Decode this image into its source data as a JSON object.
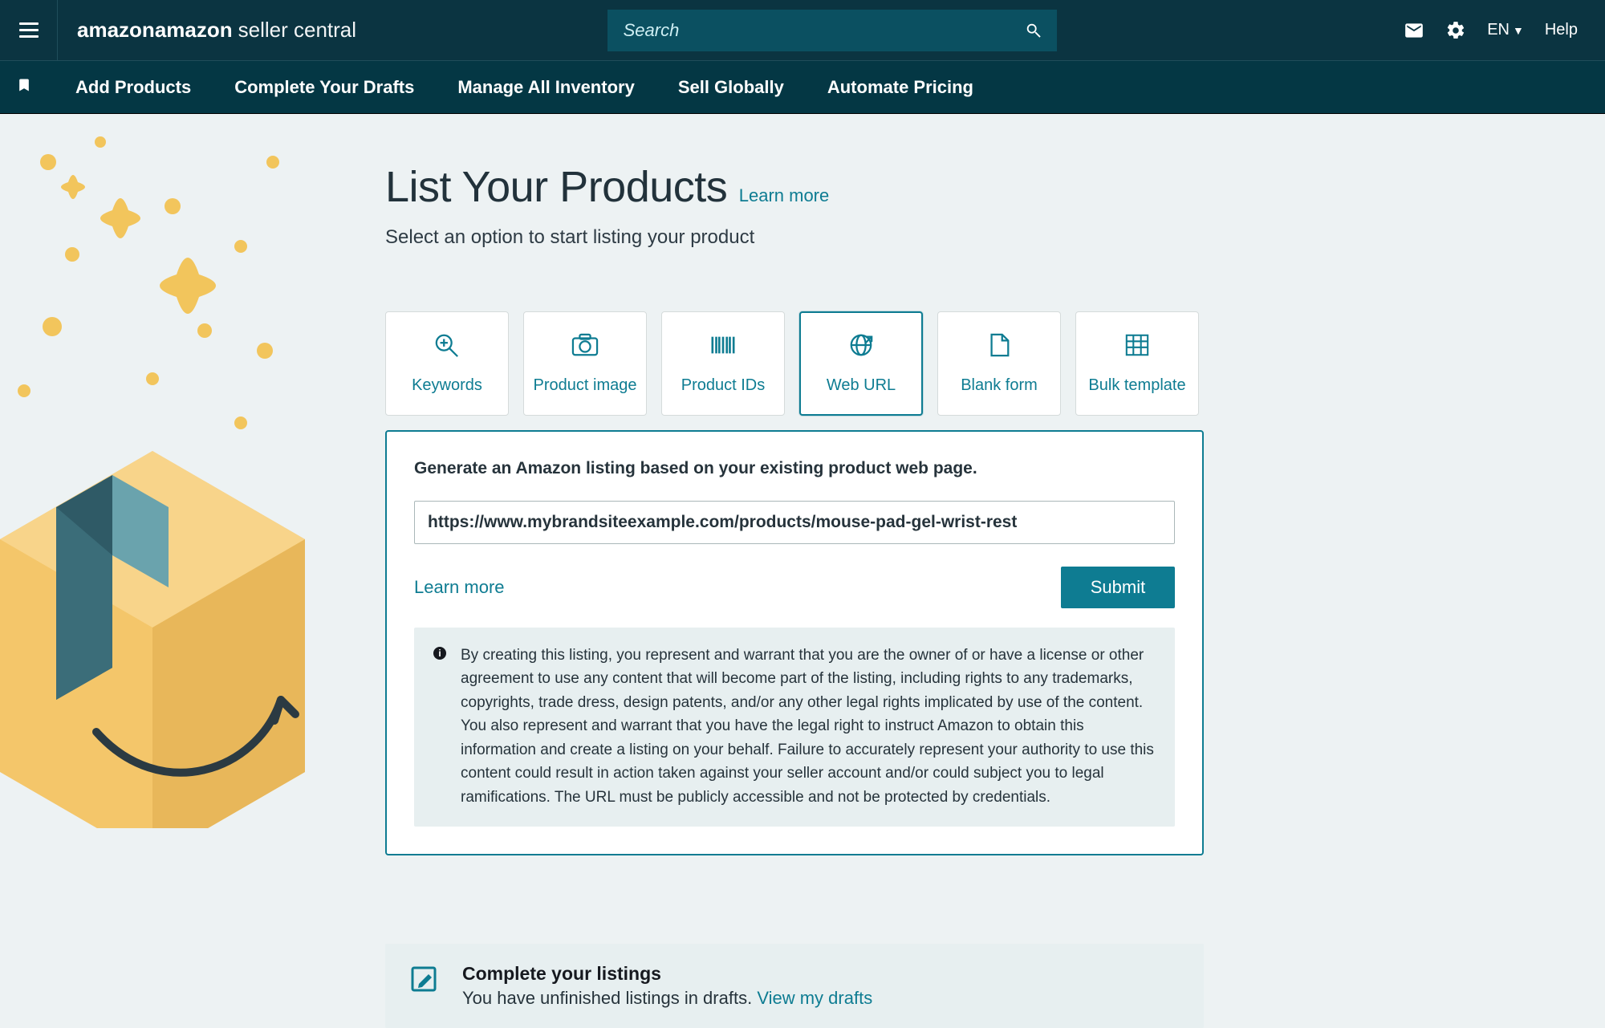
{
  "brand": {
    "first": "amazon",
    "second": "seller central"
  },
  "search": {
    "placeholder": "Search"
  },
  "lang": "EN",
  "help": "Help",
  "nav": {
    "items": [
      "Add Products",
      "Complete Your Drafts",
      "Manage All Inventory",
      "Sell Globally",
      "Automate Pricing"
    ]
  },
  "page": {
    "title": "List Your Products",
    "learn_more": "Learn more",
    "subtitle": "Select an option to start listing your product"
  },
  "options": [
    {
      "key": "keywords",
      "label": "Keywords"
    },
    {
      "key": "image",
      "label": "Product image"
    },
    {
      "key": "ids",
      "label": "Product IDs"
    },
    {
      "key": "url",
      "label": "Web URL",
      "active": true
    },
    {
      "key": "blank",
      "label": "Blank form"
    },
    {
      "key": "bulk",
      "label": "Bulk template"
    }
  ],
  "panel": {
    "description": "Generate an Amazon listing based on your existing product web page.",
    "url_value": "https://www.mybrandsiteexample.com/products/mouse-pad-gel-wrist-rest",
    "learn_more": "Learn more",
    "submit": "Submit",
    "notice": "By creating this listing, you represent and warrant that you are the owner of or have a license or other agreement to use any content that will become part of the listing, including rights to any trademarks, copyrights, trade dress, design patents, and/or any other legal rights implicated by use of the content. You also represent and warrant that you have the legal right to instruct Amazon to obtain this information and create a listing on your behalf. Failure to accurately represent your authority to use this content could result in action taken against your seller account and/or could subject you to legal ramifications. The URL must be publicly accessible and not be protected by credentials."
  },
  "drafts_banner": {
    "title": "Complete your listings",
    "text": "You have unfinished listings in drafts.",
    "link": "View my drafts"
  }
}
